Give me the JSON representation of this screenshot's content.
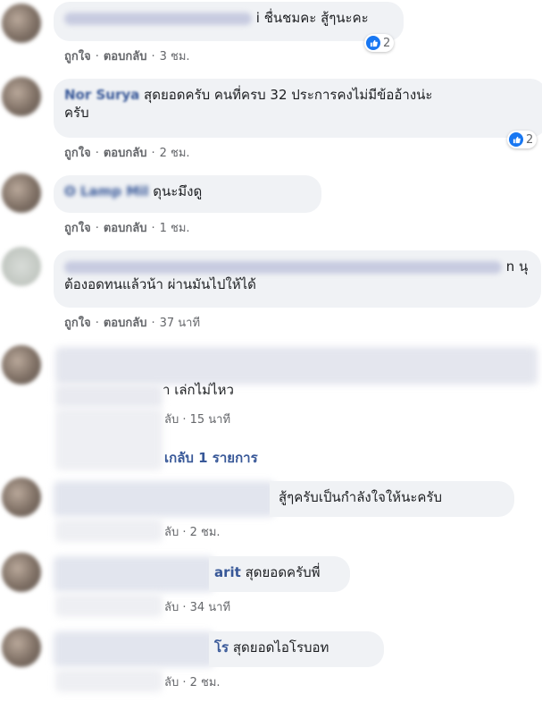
{
  "comments": [
    {
      "text": "i ชื่นชมคะ สู้ๆนะคะ",
      "reaction_count": "2",
      "actions": {
        "like": "ถูกใจ",
        "reply": "ตอบกลับ",
        "time": "3 ชม."
      }
    },
    {
      "author": "Nor Surya",
      "text_line1": "สุดยอดครับ คนที่ครบ 32 ประการคงไม่มีข้ออ้างน่ะ",
      "text_line2": "ครับ",
      "reaction_count": "2",
      "actions": {
        "like": "ถูกใจ",
        "reply": "ตอบกลับ",
        "time": "2 ชม."
      }
    },
    {
      "author": "O Lamp Mil",
      "text": "ดุนะมึงดู",
      "actions": {
        "like": "ถูกใจ",
        "reply": "ตอบกลับ",
        "time": "1 ชม."
      }
    },
    {
      "text_tail": "n นุ",
      "text_line2": "ต้องอดทนแล้วน้า ผ่านมันไปให้ได้",
      "actions": {
        "like": "ถูกใจ",
        "reply": "ตอบกลับ",
        "time": "37 นาที"
      }
    },
    {
      "text": "า เล่กไม่ไหว",
      "actions": {
        "time": "ลับ · 15 นาที"
      },
      "replies_link": "เกลับ 1 รายการ"
    },
    {
      "text": "สู้ๆครับเป็นกำลังใจให้นะครับ",
      "actions": {
        "time": "ลับ · 2 ชม."
      }
    },
    {
      "author_tail": "arit",
      "text": "สุดยอดครับพี่",
      "actions": {
        "time": "ลับ · 34 นาที"
      }
    },
    {
      "author_tail": "โร",
      "text": "สุดยอดไอโรบอท",
      "actions": {
        "time": "ลับ · 2 ชม."
      }
    }
  ]
}
